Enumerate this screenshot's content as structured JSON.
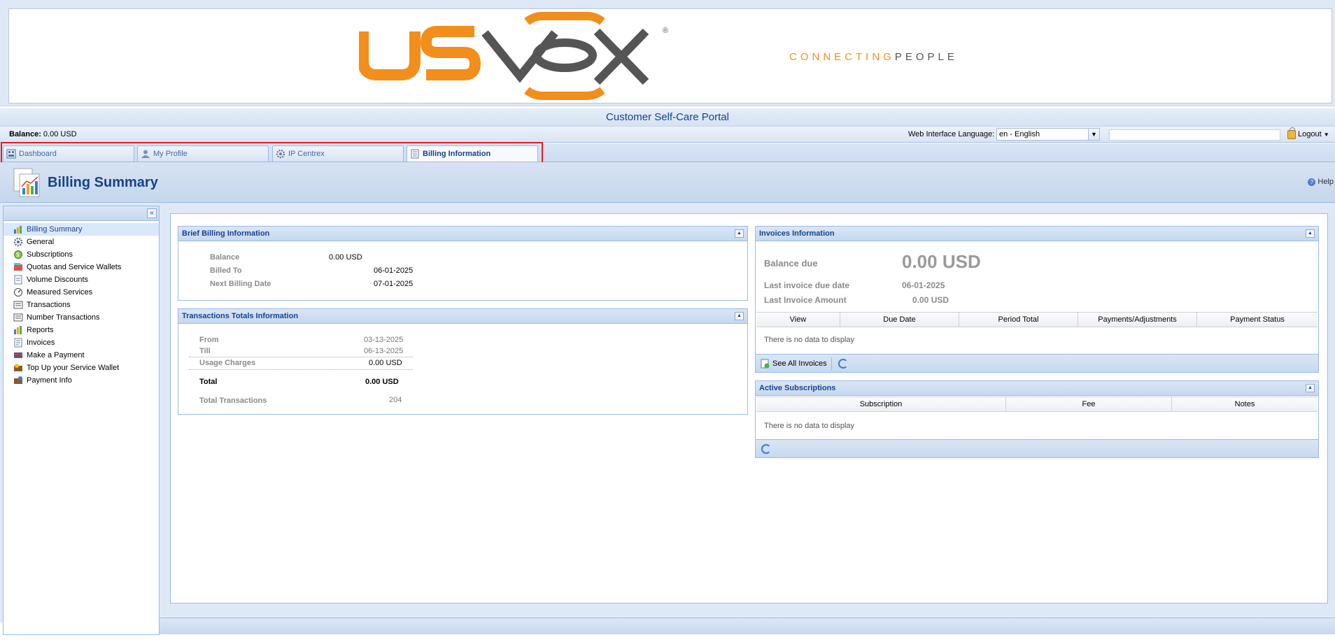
{
  "brand": {
    "tagline_part1": "CONNECTING",
    "tagline_part2": "PEOPLE",
    "accent_color": "#f28e1c",
    "logo_dark_color": "#555555"
  },
  "portal_title": "Customer Self-Care Portal",
  "toolbar": {
    "balance_label": "Balance:",
    "balance_value": "0.00 USD",
    "language_label": "Web Interface Language:",
    "language_value": "en - English",
    "search_prefix": "-",
    "logout_label": "Logout"
  },
  "tabs": [
    {
      "label": "Dashboard",
      "icon": "dashboard-icon"
    },
    {
      "label": "My Profile",
      "icon": "user-icon"
    },
    {
      "label": "IP Centrex",
      "icon": "gear-icon"
    },
    {
      "label": "Billing Information",
      "icon": "document-icon"
    }
  ],
  "page": {
    "title": "Billing Summary",
    "help_label": "Help"
  },
  "sidebar": {
    "items": [
      {
        "label": "Billing Summary",
        "icon": "chart-icon"
      },
      {
        "label": "General",
        "icon": "gear-icon"
      },
      {
        "label": "Subscriptions",
        "icon": "subscriptions-icon"
      },
      {
        "label": "Quotas and Service Wallets",
        "icon": "wallet-icon"
      },
      {
        "label": "Volume Discounts",
        "icon": "discount-icon"
      },
      {
        "label": "Measured Services",
        "icon": "meter-icon"
      },
      {
        "label": "Transactions",
        "icon": "transactions-icon"
      },
      {
        "label": "Number Transactions",
        "icon": "number-transactions-icon"
      },
      {
        "label": "Reports",
        "icon": "reports-icon"
      },
      {
        "label": "Invoices",
        "icon": "invoice-icon"
      },
      {
        "label": "Make a Payment",
        "icon": "payment-icon"
      },
      {
        "label": "Top Up your Service Wallet",
        "icon": "topup-icon"
      },
      {
        "label": "Payment Info",
        "icon": "payment-info-icon"
      }
    ]
  },
  "brief_billing": {
    "title": "Brief Billing Information",
    "balance_label": "Balance",
    "balance_value": "0.00 USD",
    "billed_to_label": "Billed To",
    "billed_to_value": "06-01-2025",
    "next_billing_label": "Next Billing Date",
    "next_billing_value": "07-01-2025"
  },
  "transactions_totals": {
    "title": "Transactions Totals Information",
    "from_label": "From",
    "from_value": "03-13-2025",
    "till_label": "Till",
    "till_value": "06-13-2025",
    "usage_label": "Usage Charges",
    "usage_value": "0.00 USD",
    "total_label": "Total",
    "total_value": "0.00 USD",
    "total_tx_label": "Total Transactions",
    "total_tx_value": "204"
  },
  "invoices": {
    "title": "Invoices Information",
    "balance_due_label": "Balance due",
    "balance_due_value": "0.00 USD",
    "last_due_label": "Last invoice due date",
    "last_due_value": "06-01-2025",
    "last_amount_label": "Last Invoice Amount",
    "last_amount_value": "0.00 USD",
    "columns": [
      "View",
      "Due Date",
      "Period Total",
      "Payments/Adjustments",
      "Payment Status"
    ],
    "empty_text": "There is no data to display",
    "see_all_label": "See All Invoices"
  },
  "subscriptions": {
    "title": "Active Subscriptions",
    "columns": [
      "Subscription",
      "Fee",
      "Notes"
    ],
    "empty_text": "There is no data to display"
  }
}
